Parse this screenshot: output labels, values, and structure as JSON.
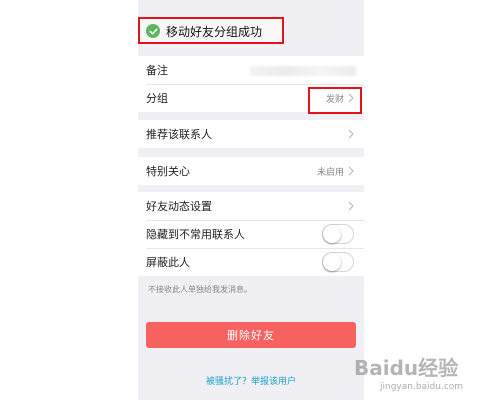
{
  "toast": {
    "text": "移动好友分组成功"
  },
  "rows": {
    "remark": {
      "label": "备注"
    },
    "group": {
      "label": "分组",
      "value": "发财"
    },
    "recommend": {
      "label": "推荐该联系人"
    },
    "special_care": {
      "label": "特别关心",
      "value": "未启用"
    },
    "feed_settings": {
      "label": "好友动态设置"
    },
    "hide_contact": {
      "label": "隐藏到不常用联系人",
      "on": false
    },
    "block": {
      "label": "屏蔽此人",
      "on": false
    }
  },
  "hint": "不接收此人单独给我发消息。",
  "delete_button": "删除好友",
  "report_link": "被骚扰了？举报该用户",
  "watermark": {
    "logo": "Baidu经验",
    "url": "jingyan.baidu.com"
  },
  "colors": {
    "danger": "#f76260",
    "link": "#1aa2c8",
    "success": "#5cb85c",
    "annotation": "#e8131a"
  }
}
